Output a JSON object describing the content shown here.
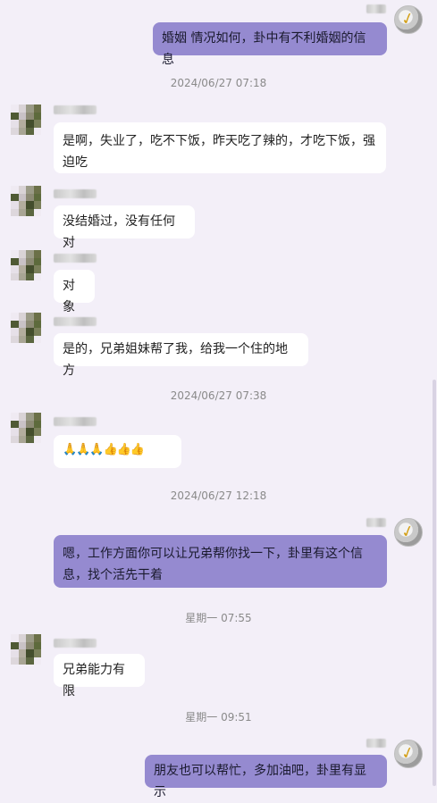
{
  "conversation": {
    "msg1": "婚姻 情况如何，卦中有不利婚姻的信息",
    "ts1": "2024/06/27 07:18",
    "msg2": "是啊，失业了，吃不下饭，昨天吃了辣的，才吃下饭，强迫吃",
    "msg3": "没结婚过，没有任何对",
    "msg4": "对象",
    "msg5": "是的，兄弟姐妹帮了我，给我一个住的地方",
    "ts2": "2024/06/27 07:38",
    "msg6": "🙏🙏🙏👍👍👍",
    "ts3": "2024/06/27 12:18",
    "msg7": "嗯，工作方面你可以让兄弟帮你找一下，卦里有这个信息，找个活先干着",
    "ts4": "星期一 07:55",
    "msg8": "兄弟能力有限",
    "ts5": "星期一 09:51",
    "msg9": "朋友也可以帮忙，多加油吧，卦里有显示"
  },
  "colors": {
    "background": "#f3eff8",
    "outgoing_bubble": "#958ad0",
    "incoming_bubble": "#ffffff",
    "timestamp_text": "#8a8a8a"
  },
  "icons": {
    "self_avatar": "avatar-self-icon",
    "contact_avatar": "avatar-contact-icon"
  }
}
